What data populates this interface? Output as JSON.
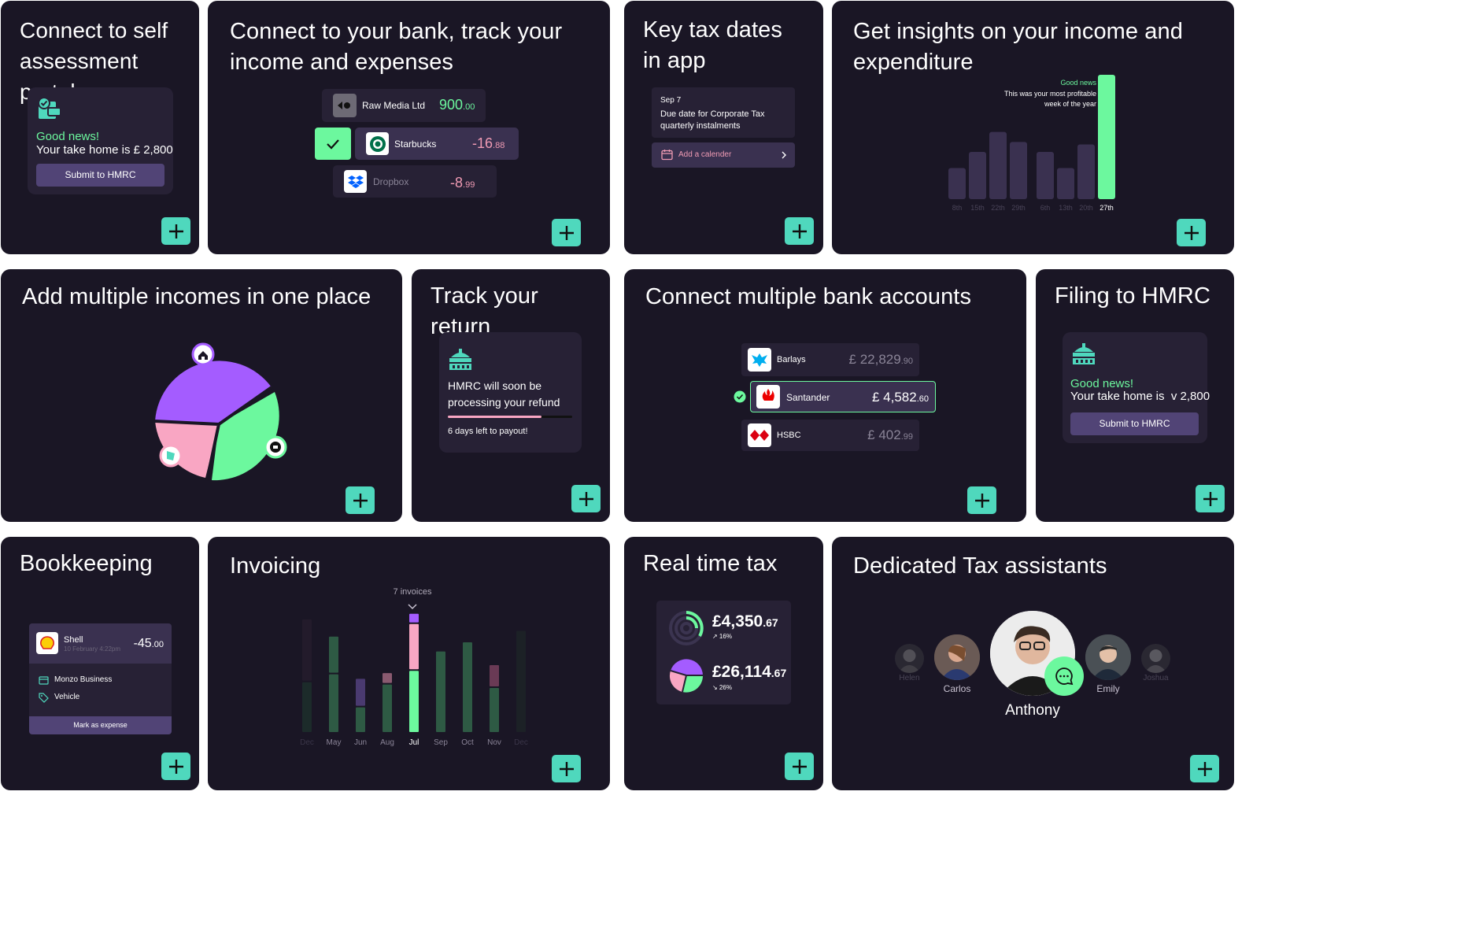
{
  "cards": {
    "self_assessment": {
      "title": "Connect to self assessment portal",
      "good_news": "Good news!",
      "take_home": "Your take home is £ 2,800",
      "button": "Submit to HMRC"
    },
    "bank_connect": {
      "title": "Connect to your bank, track your income and expenses",
      "transactions": [
        {
          "name": "Raw Media Ltd",
          "amount": "900",
          "decimals": ".00"
        },
        {
          "name": "Starbucks",
          "amount": "-16",
          "decimals": ".88"
        },
        {
          "name": "Dropbox",
          "amount": "-8",
          "decimals": ".99"
        }
      ]
    },
    "tax_dates": {
      "title": "Key tax dates in app",
      "date": "Sep 7",
      "description": "Due date for Corporate Tax quarterly instalments",
      "button": "Add a calender"
    },
    "insights": {
      "title": "Get insights on your income and expenditure",
      "annotation_good": "Good news",
      "annotation_text": "This was your most profitable week of the year",
      "bars": [
        {
          "label": "8th",
          "value": 25
        },
        {
          "label": "15th",
          "value": 38
        },
        {
          "label": "22th",
          "value": 54
        },
        {
          "label": "29th",
          "value": 46
        },
        {
          "label": "6th",
          "value": 38
        },
        {
          "label": "13th",
          "value": 25
        },
        {
          "label": "20th",
          "value": 44
        },
        {
          "label": "27th",
          "value": 100
        }
      ]
    },
    "multiple_incomes": {
      "title": "Add multiple incomes in one place"
    },
    "track_return": {
      "title": "Track your return",
      "message": "HMRC will soon be processing your refund",
      "progress": 0.75,
      "payout": "6 days left to payout!"
    },
    "multi_bank": {
      "title": "Connect multiple bank accounts",
      "accounts": [
        {
          "name": "Barlays",
          "amount": "£ 22,829",
          "decimals": ".90"
        },
        {
          "name": "Santander",
          "amount": "£ 4,582",
          "decimals": ".60"
        },
        {
          "name": "HSBC",
          "amount": "£ 402",
          "decimals": ".99"
        }
      ]
    },
    "filing": {
      "title": "Filing to HMRC",
      "good_news": "Good news!",
      "take_home": "Your take home is  v 2,800",
      "button": "Submit to HMRC"
    },
    "bookkeeping": {
      "title": "Bookkeeping",
      "merchant": "Shell",
      "date": "10 February 4:22pm",
      "amount": "-45",
      "decimals": ".00",
      "account": "Monzo Business",
      "category": "Vehicle",
      "button": "Mark as expense"
    },
    "invoicing": {
      "title": "Invoicing",
      "annotation": "7 invoices",
      "months": [
        "Dec",
        "May",
        "Jun",
        "Aug",
        "Jul",
        "Sep",
        "Oct",
        "Nov",
        "Dec"
      ]
    },
    "real_time_tax": {
      "title": "Real time tax",
      "stat1_main": "£4,350",
      "stat1_dec": ".67",
      "stat1_change": "↗ 16%",
      "stat2_main": "£26,114",
      "stat2_dec": ".67",
      "stat2_change": "↘ 26%"
    },
    "assistants": {
      "title": "Dedicated Tax assistants",
      "people": [
        "Helen",
        "Carlos",
        "Anthony",
        "Emily",
        "Joshua"
      ]
    }
  },
  "chart_data": [
    {
      "type": "bar",
      "title": "",
      "categories": [
        "8th",
        "15th",
        "22th",
        "29th",
        "6th",
        "13th",
        "20th",
        "27th"
      ],
      "values": [
        25,
        38,
        54,
        46,
        38,
        25,
        44,
        100
      ],
      "annotation": "Good news — This was your most profitable week of the year"
    },
    {
      "type": "bar",
      "title": "",
      "categories": [
        "Dec",
        "May",
        "Jun",
        "Aug",
        "Jul",
        "Sep",
        "Oct",
        "Nov",
        "Dec"
      ],
      "series": [
        {
          "values": [
            45,
            52,
            23,
            43,
            55,
            72,
            80,
            40,
            0
          ]
        },
        {
          "values": [
            55,
            33,
            25,
            10,
            41,
            0,
            0,
            20,
            90
          ]
        },
        {
          "values": [
            0,
            0,
            0,
            0,
            9,
            0,
            0,
            0,
            0
          ]
        }
      ],
      "annotation": "7 invoices"
    }
  ],
  "colors": {
    "card_bg": "#1a1625",
    "panel_bg": "#272135",
    "accent_green": "#6cf89e",
    "teal": "#4fd8bd",
    "purple": "#514476",
    "pink": "#f09bb4",
    "violet": "#a45cff"
  }
}
